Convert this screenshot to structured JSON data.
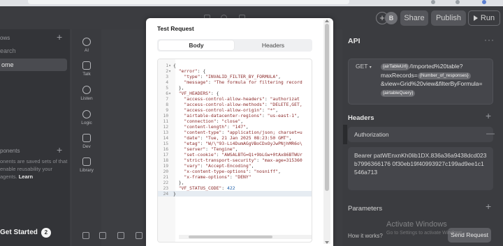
{
  "top_bar": {
    "share_label": "Share",
    "publish_label": "Publish",
    "run_label": "Run",
    "add_icon_glyph": "+",
    "avatar_initial": "B"
  },
  "left_panel": {
    "flows_title": "ows",
    "search_placeholder": "earch",
    "home_label": "ome",
    "components_title": "ponents",
    "components_desc": "onents are saved sets of that enable reusability your agents.",
    "learn_label": "Learn",
    "get_started_label": "Get Started",
    "get_started_count": "2"
  },
  "rail": {
    "items": [
      {
        "label": "AI",
        "icon": "ai-icon"
      },
      {
        "label": "Talk",
        "icon": "talk-icon"
      },
      {
        "label": "Listen",
        "icon": "listen-icon"
      },
      {
        "label": "Logic",
        "icon": "logic-icon"
      },
      {
        "label": "Dev",
        "icon": "dev-icon"
      },
      {
        "label": "Library",
        "icon": "library-icon"
      }
    ]
  },
  "modal": {
    "title": "Test Request",
    "tabs": [
      "Body",
      "Headers"
    ],
    "active_tab": "Body",
    "code_lines": [
      [
        {
          "t": "{",
          "c": "cdef"
        }
      ],
      [
        {
          "t": "  ",
          "c": "cdef"
        },
        {
          "t": "\"error\"",
          "c": "ct"
        },
        {
          "t": ": {",
          "c": "cdef"
        }
      ],
      [
        {
          "t": "    ",
          "c": "cdef"
        },
        {
          "t": "\"type\"",
          "c": "ct"
        },
        {
          "t": ": ",
          "c": "cdef"
        },
        {
          "t": "\"INVALID_FILTER_BY_FORMULA\"",
          "c": "ct"
        },
        {
          "t": ",",
          "c": "cdef"
        }
      ],
      [
        {
          "t": "    ",
          "c": "cdef"
        },
        {
          "t": "\"message\"",
          "c": "ct"
        },
        {
          "t": ": ",
          "c": "cdef"
        },
        {
          "t": "\"The formula for filtering record",
          "c": "ct"
        }
      ],
      [
        {
          "t": "  },",
          "c": "cdef"
        }
      ],
      [
        {
          "t": "  ",
          "c": "cdef"
        },
        {
          "t": "\"VF_HEADERS\"",
          "c": "ct"
        },
        {
          "t": ": {",
          "c": "cdef"
        }
      ],
      [
        {
          "t": "    ",
          "c": "cdef"
        },
        {
          "t": "\"access-control-allow-headers\"",
          "c": "ct"
        },
        {
          "t": ": ",
          "c": "cdef"
        },
        {
          "t": "\"authorizat",
          "c": "ct"
        }
      ],
      [
        {
          "t": "    ",
          "c": "cdef"
        },
        {
          "t": "\"access-control-allow-methods\"",
          "c": "ct"
        },
        {
          "t": ": ",
          "c": "cdef"
        },
        {
          "t": "\"DELETE,GET,",
          "c": "ct"
        }
      ],
      [
        {
          "t": "    ",
          "c": "cdef"
        },
        {
          "t": "\"access-control-allow-origin\"",
          "c": "ct"
        },
        {
          "t": ": ",
          "c": "cdef"
        },
        {
          "t": "\"*\"",
          "c": "ct"
        },
        {
          "t": ",",
          "c": "cdef"
        }
      ],
      [
        {
          "t": "    ",
          "c": "cdef"
        },
        {
          "t": "\"airtable-datacenter-regions\"",
          "c": "ct"
        },
        {
          "t": ": ",
          "c": "cdef"
        },
        {
          "t": "\"us-east-1\"",
          "c": "ct"
        },
        {
          "t": ",",
          "c": "cdef"
        }
      ],
      [
        {
          "t": "    ",
          "c": "cdef"
        },
        {
          "t": "\"connection\"",
          "c": "ct"
        },
        {
          "t": ": ",
          "c": "cdef"
        },
        {
          "t": "\"close\"",
          "c": "ct"
        },
        {
          "t": ",",
          "c": "cdef"
        }
      ],
      [
        {
          "t": "    ",
          "c": "cdef"
        },
        {
          "t": "\"content-length\"",
          "c": "ct"
        },
        {
          "t": ": ",
          "c": "cdef"
        },
        {
          "t": "\"147\"",
          "c": "ct"
        },
        {
          "t": ",",
          "c": "cdef"
        }
      ],
      [
        {
          "t": "    ",
          "c": "cdef"
        },
        {
          "t": "\"content-type\"",
          "c": "ct"
        },
        {
          "t": ": ",
          "c": "cdef"
        },
        {
          "t": "\"application/json; charset=u",
          "c": "ct"
        }
      ],
      [
        {
          "t": "    ",
          "c": "cdef"
        },
        {
          "t": "\"date\"",
          "c": "ct"
        },
        {
          "t": ": ",
          "c": "cdef"
        },
        {
          "t": "\"Tue, 21 Jan 2025 08:23:50 GMT\"",
          "c": "ct"
        },
        {
          "t": ",",
          "c": "cdef"
        }
      ],
      [
        {
          "t": "    ",
          "c": "cdef"
        },
        {
          "t": "\"etag\"",
          "c": "ct"
        },
        {
          "t": ": ",
          "c": "cdef"
        },
        {
          "t": "\"W/\\\"93-Li4DumAGgVBoCDxOyJwPNjhMR6o\\",
          "c": "ct"
        }
      ],
      [
        {
          "t": "    ",
          "c": "cdef"
        },
        {
          "t": "\"server\"",
          "c": "ct"
        },
        {
          "t": ": ",
          "c": "cdef"
        },
        {
          "t": "\"Tengine\"",
          "c": "ct"
        },
        {
          "t": ",",
          "c": "cdef"
        }
      ],
      [
        {
          "t": "    ",
          "c": "cdef"
        },
        {
          "t": "\"set-cookie\"",
          "c": "ct"
        },
        {
          "t": ": ",
          "c": "cdef"
        },
        {
          "t": "\"AWSALBTG=Qi+9bLGw+0tAx86BTWUr",
          "c": "ct"
        }
      ],
      [
        {
          "t": "    ",
          "c": "cdef"
        },
        {
          "t": "\"strict-transport-security\"",
          "c": "ct"
        },
        {
          "t": ": ",
          "c": "cdef"
        },
        {
          "t": "\"max-age=315360",
          "c": "ct"
        }
      ],
      [
        {
          "t": "    ",
          "c": "cdef"
        },
        {
          "t": "\"vary\"",
          "c": "ct"
        },
        {
          "t": ": ",
          "c": "cdef"
        },
        {
          "t": "\"Accept-Encoding\"",
          "c": "ct"
        },
        {
          "t": ",",
          "c": "cdef"
        }
      ],
      [
        {
          "t": "    ",
          "c": "cdef"
        },
        {
          "t": "\"x-content-type-options\"",
          "c": "ct"
        },
        {
          "t": ": ",
          "c": "cdef"
        },
        {
          "t": "\"nosniff\"",
          "c": "ct"
        },
        {
          "t": ",",
          "c": "cdef"
        }
      ],
      [
        {
          "t": "    ",
          "c": "cdef"
        },
        {
          "t": "\"x-frame-options\"",
          "c": "ct"
        },
        {
          "t": ": ",
          "c": "cdef"
        },
        {
          "t": "\"DENY\"",
          "c": "ct"
        }
      ],
      [
        {
          "t": "  },",
          "c": "cdef"
        }
      ],
      [
        {
          "t": "  ",
          "c": "cdef"
        },
        {
          "t": "\"VF_STATUS_CODE\"",
          "c": "ct"
        },
        {
          "t": ": ",
          "c": "cdef"
        },
        {
          "t": "422",
          "c": "cnum"
        }
      ],
      [
        {
          "t": "}",
          "c": "cdef"
        }
      ]
    ],
    "fold_lines": [
      1,
      2,
      6
    ],
    "active_line": 24
  },
  "right_panel": {
    "title": "API",
    "more_glyph": "···",
    "method": "GET",
    "url_var_1": "{airTableUrl}",
    "url_text_1": "/Imported%20table?",
    "url_text_2": "maxRecords=",
    "url_var_2": "{Number_of_responses}",
    "url_text_3": "&view=Grid%20view&filterByFormula=",
    "url_var_3": "{airtableQuery}",
    "headers_title": "Headers",
    "header_name": "Authorization",
    "header_value": "Bearer patWEnxnKh0lib1DX.836a36a9438dcd023b7996366176 0f30eb19f40993927c199ad9ee1c1546a713",
    "parameters_title": "Parameters",
    "how_it_works": "How it works?",
    "send_request": "Send Request"
  },
  "watermark": {
    "line1": "Activate Windows",
    "line2": "Go to Settings to activate Windows."
  },
  "colors": {
    "modal_bg": "#ffffff",
    "app_bg": "#3d3e42",
    "code_string": "#8b2a2a",
    "code_number": "#1e5fa8"
  }
}
